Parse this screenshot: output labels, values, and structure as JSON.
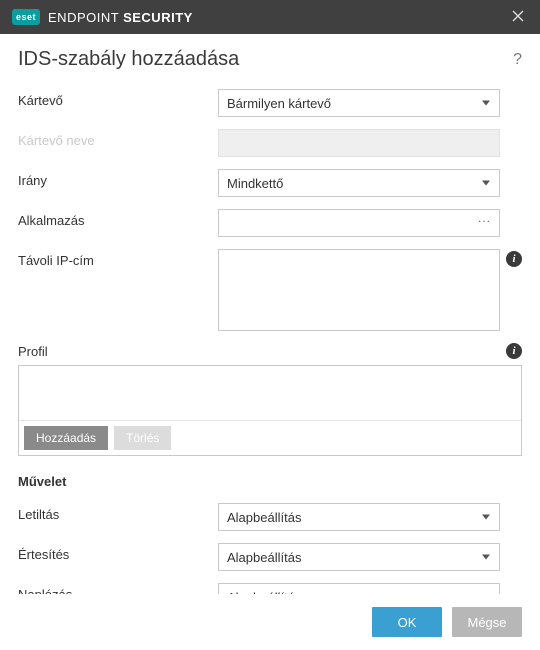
{
  "titlebar": {
    "brand_badge": "eset",
    "brand_light": "ENDPOINT ",
    "brand_bold": "SECURITY"
  },
  "page": {
    "title": "IDS-szabály hozzáadása"
  },
  "fields": {
    "threat_label": "Kártevő",
    "threat_value": "Bármilyen kártevő",
    "threat_name_label": "Kártevő neve",
    "direction_label": "Irány",
    "direction_value": "Mindkettő",
    "application_label": "Alkalmazás",
    "remote_ip_label": "Távoli IP-cím",
    "profile_label": "Profil"
  },
  "profile_buttons": {
    "add": "Hozzáadás",
    "delete": "Törlés"
  },
  "action": {
    "section": "Művelet",
    "block_label": "Letiltás",
    "block_value": "Alapbeállítás",
    "notify_label": "Értesítés",
    "notify_value": "Alapbeállítás",
    "log_label": "Naplózás",
    "log_value": "Alapbeállítás"
  },
  "footer": {
    "ok": "OK",
    "cancel": "Mégse"
  }
}
